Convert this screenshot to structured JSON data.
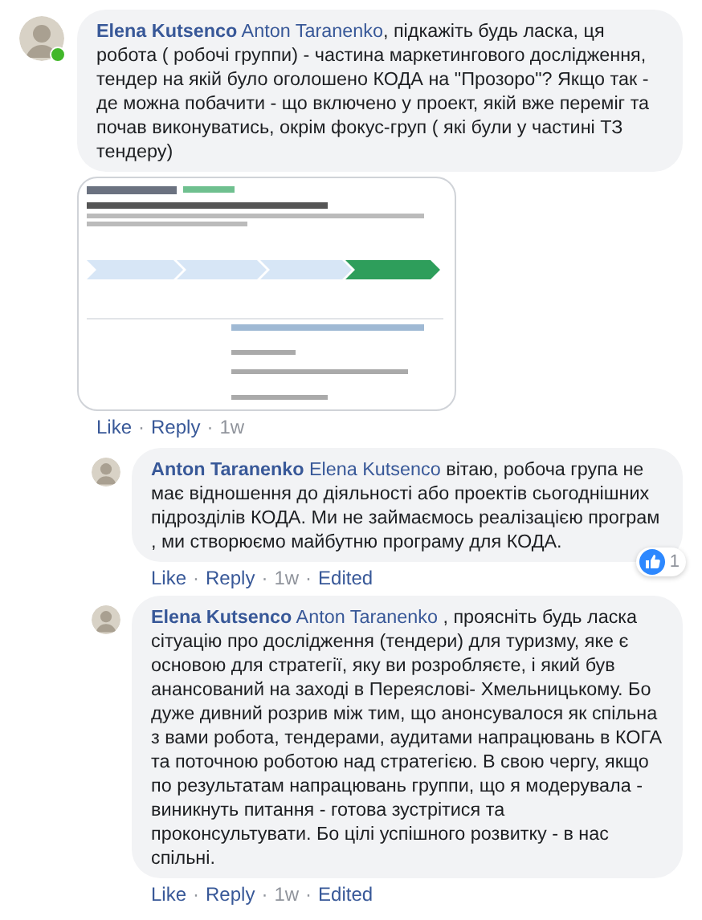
{
  "comments": [
    {
      "author": "Elena Kutsenco",
      "mention": "Anton Taranenko",
      "text": ", підкажіть будь ласка, ця робота ( робочі группи) - частина маркетингового дослідження, тендер на якій було оголошено КОДА на \"Прозоро\"? Якщо так - де можна побачити - що включено у проект, якій вже переміг та почав виконуватись, окрім фокус-груп ( які були у частині ТЗ тендеру)",
      "online": true,
      "attachment": {
        "kind": "picture"
      },
      "separator": "·",
      "actions": [
        {
          "label": "Like",
          "kind": "link"
        },
        {
          "label": "Reply",
          "kind": "link"
        },
        {
          "label": "1w",
          "kind": "time"
        }
      ],
      "children": [
        {
          "author": "Anton Taranenko",
          "mention": "Elena Kutsenco",
          "text": " вітаю, робоча група не має відношення до діяльності або проектів сьогоднішних підрозділів КОДА. Ми не займаємось реалізацією програм , ми створюємо майбутню програму для КОДА.",
          "online": false,
          "reaction_count": "1",
          "separator": "·",
          "actions": [
            {
              "label": "Like",
              "kind": "link"
            },
            {
              "label": "Reply",
              "kind": "link"
            },
            {
              "label": "1w",
              "kind": "time"
            },
            {
              "label": "Edited",
              "kind": "link"
            }
          ]
        },
        {
          "author": "Elena Kutsenco",
          "mention": "Anton Taranenko",
          "text": " , проясніть будь ласка сітуацію про дослідження (тендери) для туризму, яке є основою для стратегії, яку ви розробляєте, і який був анансований на заході в Переяслові- Хмельницькому. Бо дуже дивний розрив між тим, що анонсувалося як спільна з вами робота, тендерами, аудитами напрацювань в КОГА та поточною роботою над стратегією. В свою чергу, якщо по результатам напрацювань группи, що я модерувала - виникнуть питання - готова зустрітися та проконсультувати. Бо цілі успішного розвитку - в нас спільні.",
          "online": false,
          "separator": "·",
          "actions": [
            {
              "label": "Like",
              "kind": "link"
            },
            {
              "label": "Reply",
              "kind": "link"
            },
            {
              "label": "1w",
              "kind": "time"
            },
            {
              "label": "Edited",
              "kind": "link"
            }
          ]
        }
      ]
    }
  ]
}
